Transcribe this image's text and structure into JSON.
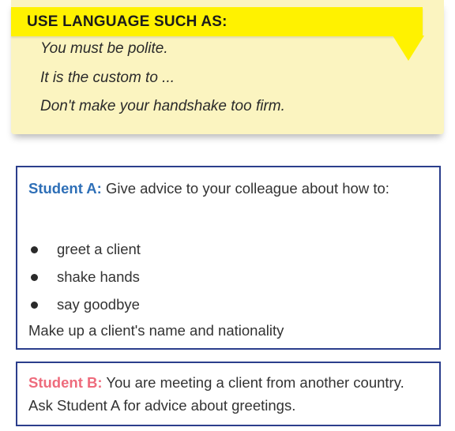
{
  "tip_box": {
    "heading": "USE LANGUAGE SUCH AS:",
    "phrases": [
      "You must be polite.",
      "It is the custom to ...",
      "Don't make your handshake too firm."
    ],
    "colors": {
      "header": "#fff200",
      "panel": "#fbf4c0"
    }
  },
  "student_a": {
    "label": "Student A:",
    "instruction": "Give advice to your colleague about how to:",
    "bullets": [
      "greet a client",
      "shake hands",
      "say goodbye"
    ],
    "closing": "Make up a client's name and nationality",
    "label_color": "#2e6fb7"
  },
  "student_b": {
    "label": "Student B:",
    "instruction": "You are meeting a client from another country. Ask Student A for advice about greetings.",
    "label_color": "#ee6b7c"
  },
  "border_color": "#2b3e8c"
}
